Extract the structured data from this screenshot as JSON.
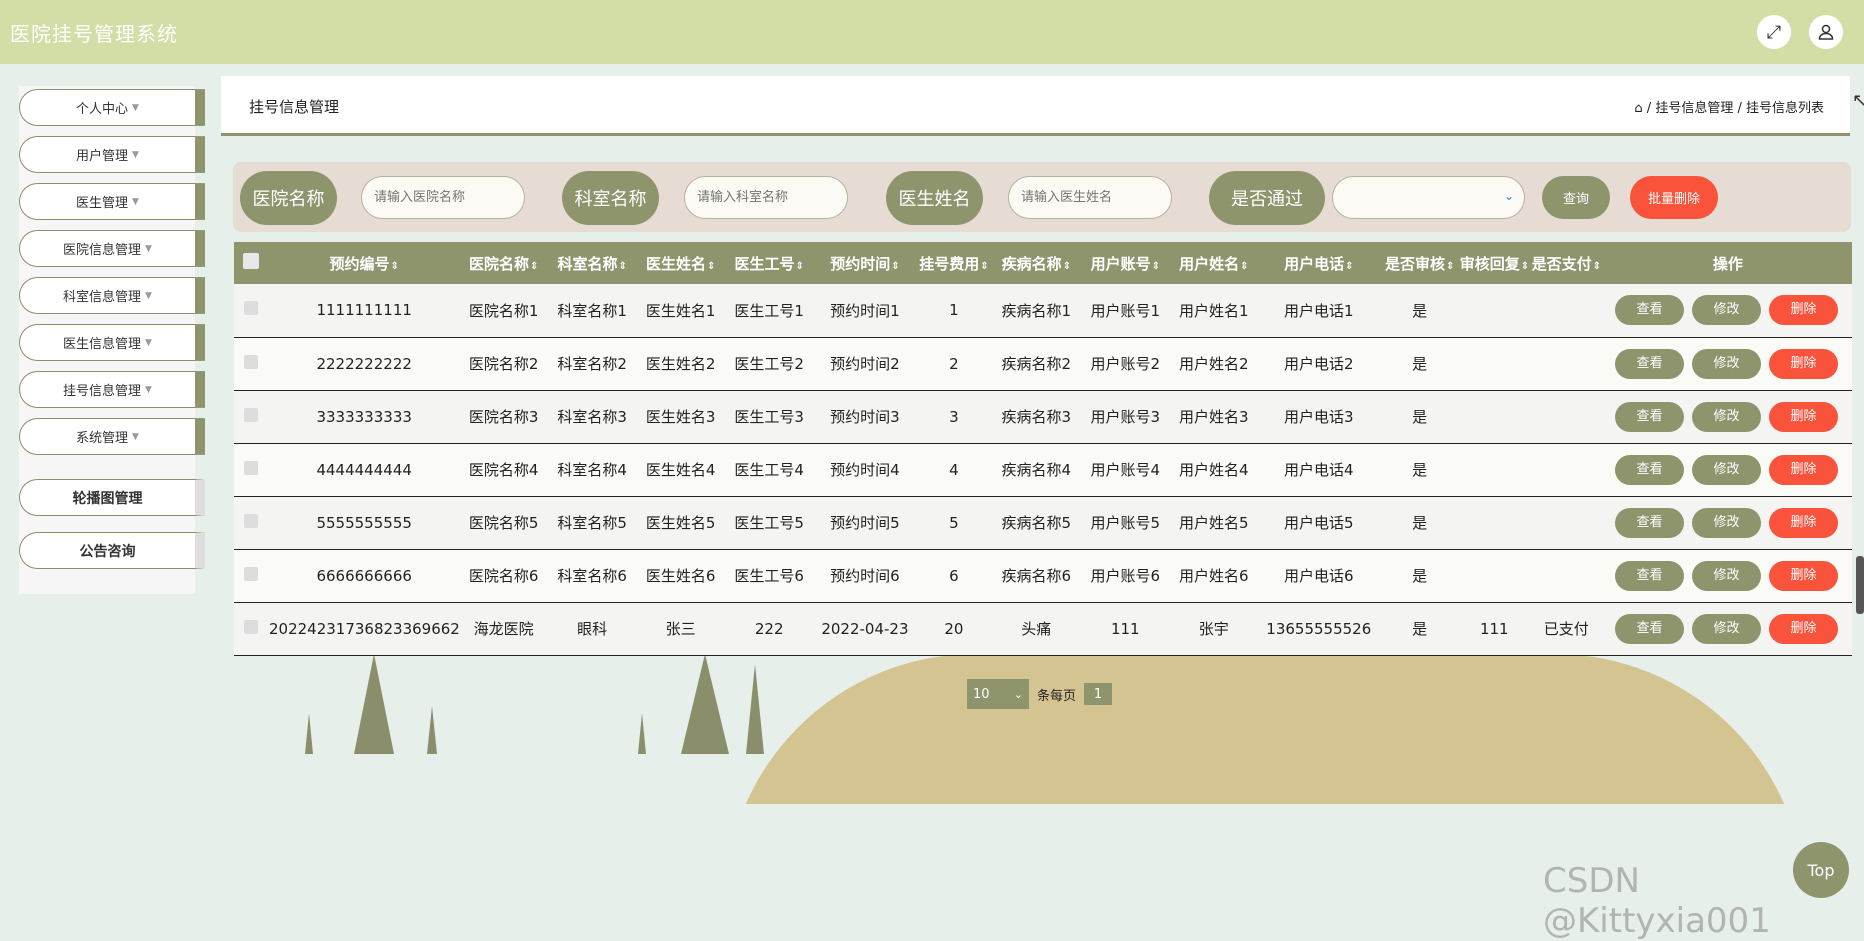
{
  "app": {
    "title": "医院挂号管理系统"
  },
  "header_icons": [
    "fullscreen-icon",
    "user-icon"
  ],
  "sidebar": {
    "items": [
      {
        "label": "个人中心",
        "caret": true
      },
      {
        "label": "用户管理",
        "caret": true
      },
      {
        "label": "医生管理",
        "caret": true
      },
      {
        "label": "医院信息管理",
        "caret": true
      },
      {
        "label": "科室信息管理",
        "caret": true
      },
      {
        "label": "医生信息管理",
        "caret": true
      },
      {
        "label": "挂号信息管理",
        "caret": true
      },
      {
        "label": "系统管理",
        "caret": true
      },
      {
        "label": "轮播图管理",
        "caret": false
      },
      {
        "label": "公告咨询",
        "caret": false
      }
    ]
  },
  "page": {
    "title": "挂号信息管理",
    "breadcrumb": [
      "挂号信息管理",
      "挂号信息列表"
    ]
  },
  "search": {
    "hospital_label": "医院名称",
    "hospital_placeholder": "请输入医院名称",
    "dept_label": "科室名称",
    "dept_placeholder": "请输入科室名称",
    "doctor_label": "医生姓名",
    "doctor_placeholder": "请输入医生姓名",
    "passed_label": "是否通过",
    "passed_value": "",
    "query_button": "查询",
    "batch_delete_button": "批量删除"
  },
  "table": {
    "columns": [
      "预约编号",
      "医院名称",
      "科室名称",
      "医生姓名",
      "医生工号",
      "预约时间",
      "挂号费用",
      "疾病名称",
      "用户账号",
      "用户姓名",
      "用户电话",
      "是否审核",
      "审核回复",
      "是否支付"
    ],
    "action_header": "操作",
    "actions": {
      "view": "查看",
      "edit": "修改",
      "delete": "删除"
    },
    "rows": [
      [
        "1111111111",
        "医院名称1",
        "科室名称1",
        "医生姓名1",
        "医生工号1",
        "预约时间1",
        "1",
        "疾病名称1",
        "用户账号1",
        "用户姓名1",
        "用户电话1",
        "是",
        "",
        ""
      ],
      [
        "2222222222",
        "医院名称2",
        "科室名称2",
        "医生姓名2",
        "医生工号2",
        "预约时间2",
        "2",
        "疾病名称2",
        "用户账号2",
        "用户姓名2",
        "用户电话2",
        "是",
        "",
        ""
      ],
      [
        "3333333333",
        "医院名称3",
        "科室名称3",
        "医生姓名3",
        "医生工号3",
        "预约时间3",
        "3",
        "疾病名称3",
        "用户账号3",
        "用户姓名3",
        "用户电话3",
        "是",
        "",
        ""
      ],
      [
        "4444444444",
        "医院名称4",
        "科室名称4",
        "医生姓名4",
        "医生工号4",
        "预约时间4",
        "4",
        "疾病名称4",
        "用户账号4",
        "用户姓名4",
        "用户电话4",
        "是",
        "",
        ""
      ],
      [
        "5555555555",
        "医院名称5",
        "科室名称5",
        "医生姓名5",
        "医生工号5",
        "预约时间5",
        "5",
        "疾病名称5",
        "用户账号5",
        "用户姓名5",
        "用户电话5",
        "是",
        "",
        ""
      ],
      [
        "6666666666",
        "医院名称6",
        "科室名称6",
        "医生姓名6",
        "医生工号6",
        "预约时间6",
        "6",
        "疾病名称6",
        "用户账号6",
        "用户姓名6",
        "用户电话6",
        "是",
        "",
        ""
      ],
      [
        "20224231736823369662",
        "海龙医院",
        "眼科",
        "张三",
        "222",
        "2022-04-23",
        "20",
        "头痛",
        "111",
        "张宇",
        "13655555526",
        "是",
        "111",
        "已支付"
      ]
    ]
  },
  "pagination": {
    "page_size": "10",
    "per_page_label": "条每页",
    "current_page": "1"
  },
  "top_button": "Top",
  "watermark": "CSDN @Kittyxia001",
  "colors": {
    "header": "#d3dda6",
    "accent": "#8e956d",
    "danger": "#f9533b",
    "search_bg": "#e6dcd3"
  }
}
